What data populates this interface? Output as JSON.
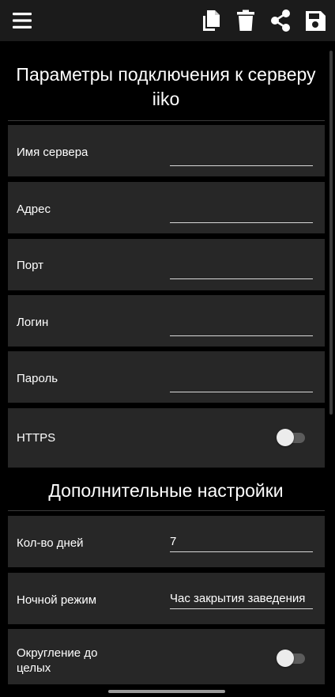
{
  "toolbar": {
    "menu_icon": "menu-icon",
    "copy_icon": "copy-icon",
    "delete_icon": "trash-icon",
    "share_icon": "share-icon",
    "save_icon": "save-icon"
  },
  "connection": {
    "title": "Параметры подключения к серверу iiko",
    "fields": [
      {
        "label": "Имя сервера",
        "value": ""
      },
      {
        "label": "Адрес",
        "value": ""
      },
      {
        "label": "Порт",
        "value": ""
      },
      {
        "label": "Логин",
        "value": ""
      },
      {
        "label": "Пароль",
        "value": ""
      }
    ],
    "https": {
      "label": "HTTPS",
      "enabled": false
    }
  },
  "additional": {
    "title": "Дополнительные настройки",
    "days": {
      "label": "Кол-во дней",
      "value": "7"
    },
    "night_mode": {
      "label": "Ночной режим",
      "value": "Час закрытия заведения"
    },
    "rounding": {
      "label": "Округление до целых",
      "enabled": false
    }
  },
  "colors": {
    "toolbar_bg": "#1b1b1b",
    "background": "#000000",
    "row_bg": "#272727",
    "text": "#ffffff",
    "switch_track": "#5c5c5c",
    "switch_thumb": "#ececec"
  }
}
